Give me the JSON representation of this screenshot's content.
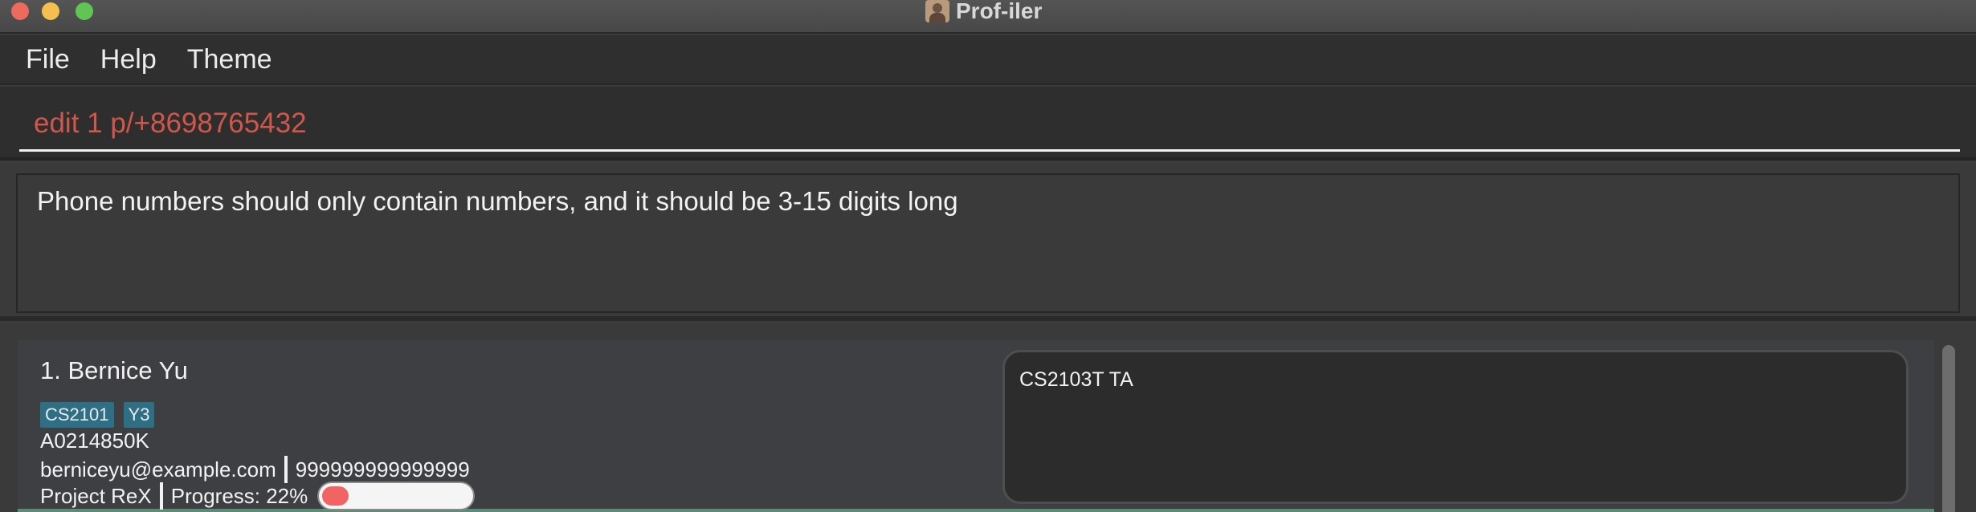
{
  "window": {
    "title": "Prof-iler"
  },
  "menu": {
    "file": "File",
    "help": "Help",
    "theme": "Theme"
  },
  "command_box": {
    "value": "edit 1 p/+8698765432"
  },
  "result_display": {
    "message": "Phone numbers should only contain numbers, and it should be 3-15 digits long"
  },
  "person_list": [
    {
      "name": "1. Bernice Yu",
      "tags": [
        "CS2101",
        "Y3"
      ],
      "student_id": "A0214850K",
      "email": "berniceyu@example.com",
      "phone": "999999999999999",
      "project": "Project ReX",
      "progress_label": "Progress: 22%",
      "progress_value": 0.22,
      "notes": "CS2103T TA"
    }
  ],
  "colors": {
    "command_error": "#d0574a",
    "tag_background": "#2f6f85",
    "progress_fill": "#f26464",
    "selected_card_border": "#5e8a78"
  }
}
